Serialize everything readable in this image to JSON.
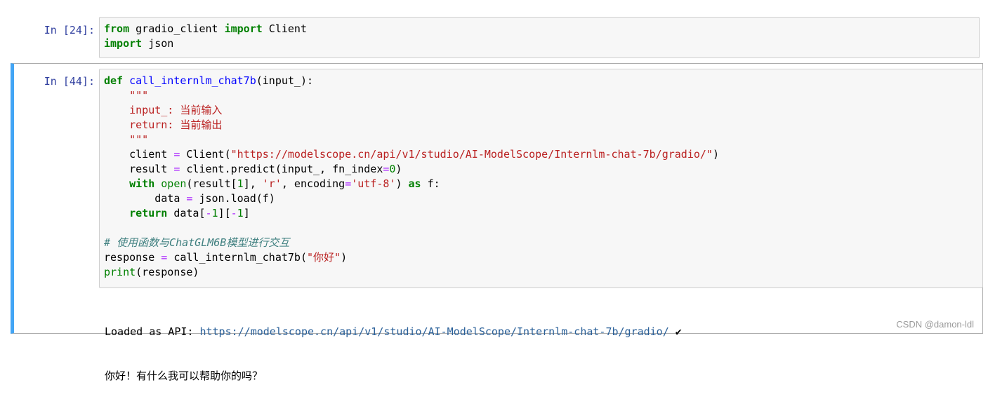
{
  "cell1": {
    "prompt": "In  [24]:",
    "lines": [
      [
        [
          "kw",
          "from"
        ],
        [
          "t",
          " gradio_client "
        ],
        [
          "kw",
          "import"
        ],
        [
          "t",
          " Client"
        ]
      ],
      [
        [
          "kw",
          "import"
        ],
        [
          "t",
          " json"
        ]
      ]
    ]
  },
  "cell2": {
    "prompt": "In  [44]:",
    "lines": [
      [
        [
          "kw",
          "def"
        ],
        [
          "t",
          " "
        ],
        [
          "fn",
          "call_internlm_chat7b"
        ],
        [
          "t",
          "(input_):"
        ]
      ],
      [
        [
          "t",
          "    "
        ],
        [
          "str",
          "\"\"\""
        ]
      ],
      [
        [
          "t",
          "    "
        ],
        [
          "str",
          "input_: 当前输入"
        ]
      ],
      [
        [
          "t",
          "    "
        ],
        [
          "str",
          "return: 当前输出"
        ]
      ],
      [
        [
          "t",
          "    "
        ],
        [
          "str",
          "\"\"\""
        ]
      ],
      [
        [
          "t",
          "    client "
        ],
        [
          "op",
          "="
        ],
        [
          "t",
          " Client("
        ],
        [
          "str",
          "\"https://modelscope.cn/api/v1/studio/AI-ModelScope/Internlm-chat-7b/gradio/\""
        ],
        [
          "t",
          ")"
        ]
      ],
      [
        [
          "t",
          "    result "
        ],
        [
          "op",
          "="
        ],
        [
          "t",
          " client.predict(input_, fn_index"
        ],
        [
          "op",
          "="
        ],
        [
          "num",
          "0"
        ],
        [
          "t",
          ")"
        ]
      ],
      [
        [
          "t",
          "    "
        ],
        [
          "kw",
          "with"
        ],
        [
          "t",
          " "
        ],
        [
          "bi",
          "open"
        ],
        [
          "t",
          "(result["
        ],
        [
          "num",
          "1"
        ],
        [
          "t",
          "], "
        ],
        [
          "str",
          "'r'"
        ],
        [
          "t",
          ", encoding"
        ],
        [
          "op",
          "="
        ],
        [
          "str",
          "'utf-8'"
        ],
        [
          "t",
          ") "
        ],
        [
          "kw",
          "as"
        ],
        [
          "t",
          " f:"
        ]
      ],
      [
        [
          "t",
          "        data "
        ],
        [
          "op",
          "="
        ],
        [
          "t",
          " json.load(f)"
        ]
      ],
      [
        [
          "t",
          "    "
        ],
        [
          "kw",
          "return"
        ],
        [
          "t",
          " data["
        ],
        [
          "op",
          "-"
        ],
        [
          "num",
          "1"
        ],
        [
          "t",
          "]["
        ],
        [
          "op",
          "-"
        ],
        [
          "num",
          "1"
        ],
        [
          "t",
          "]"
        ]
      ],
      [
        [
          "t",
          ""
        ]
      ],
      [
        [
          "cm",
          "# 使用函数与ChatGLM6B模型进行交互"
        ]
      ],
      [
        [
          "t",
          "response "
        ],
        [
          "op",
          "="
        ],
        [
          "t",
          " call_internlm_chat7b("
        ],
        [
          "str",
          "\"你好\""
        ],
        [
          "t",
          ")"
        ]
      ],
      [
        [
          "bi",
          "print"
        ],
        [
          "t",
          "(response)"
        ]
      ]
    ],
    "output": {
      "loaded_prefix": "Loaded as API: ",
      "loaded_url": "https://modelscope.cn/api/v1/studio/AI-ModelScope/Internlm-chat-7b/gradio/",
      "check": " ✔",
      "response": "你好！有什么我可以帮助你的吗？"
    }
  },
  "watermark": "CSDN @damon-ldl"
}
